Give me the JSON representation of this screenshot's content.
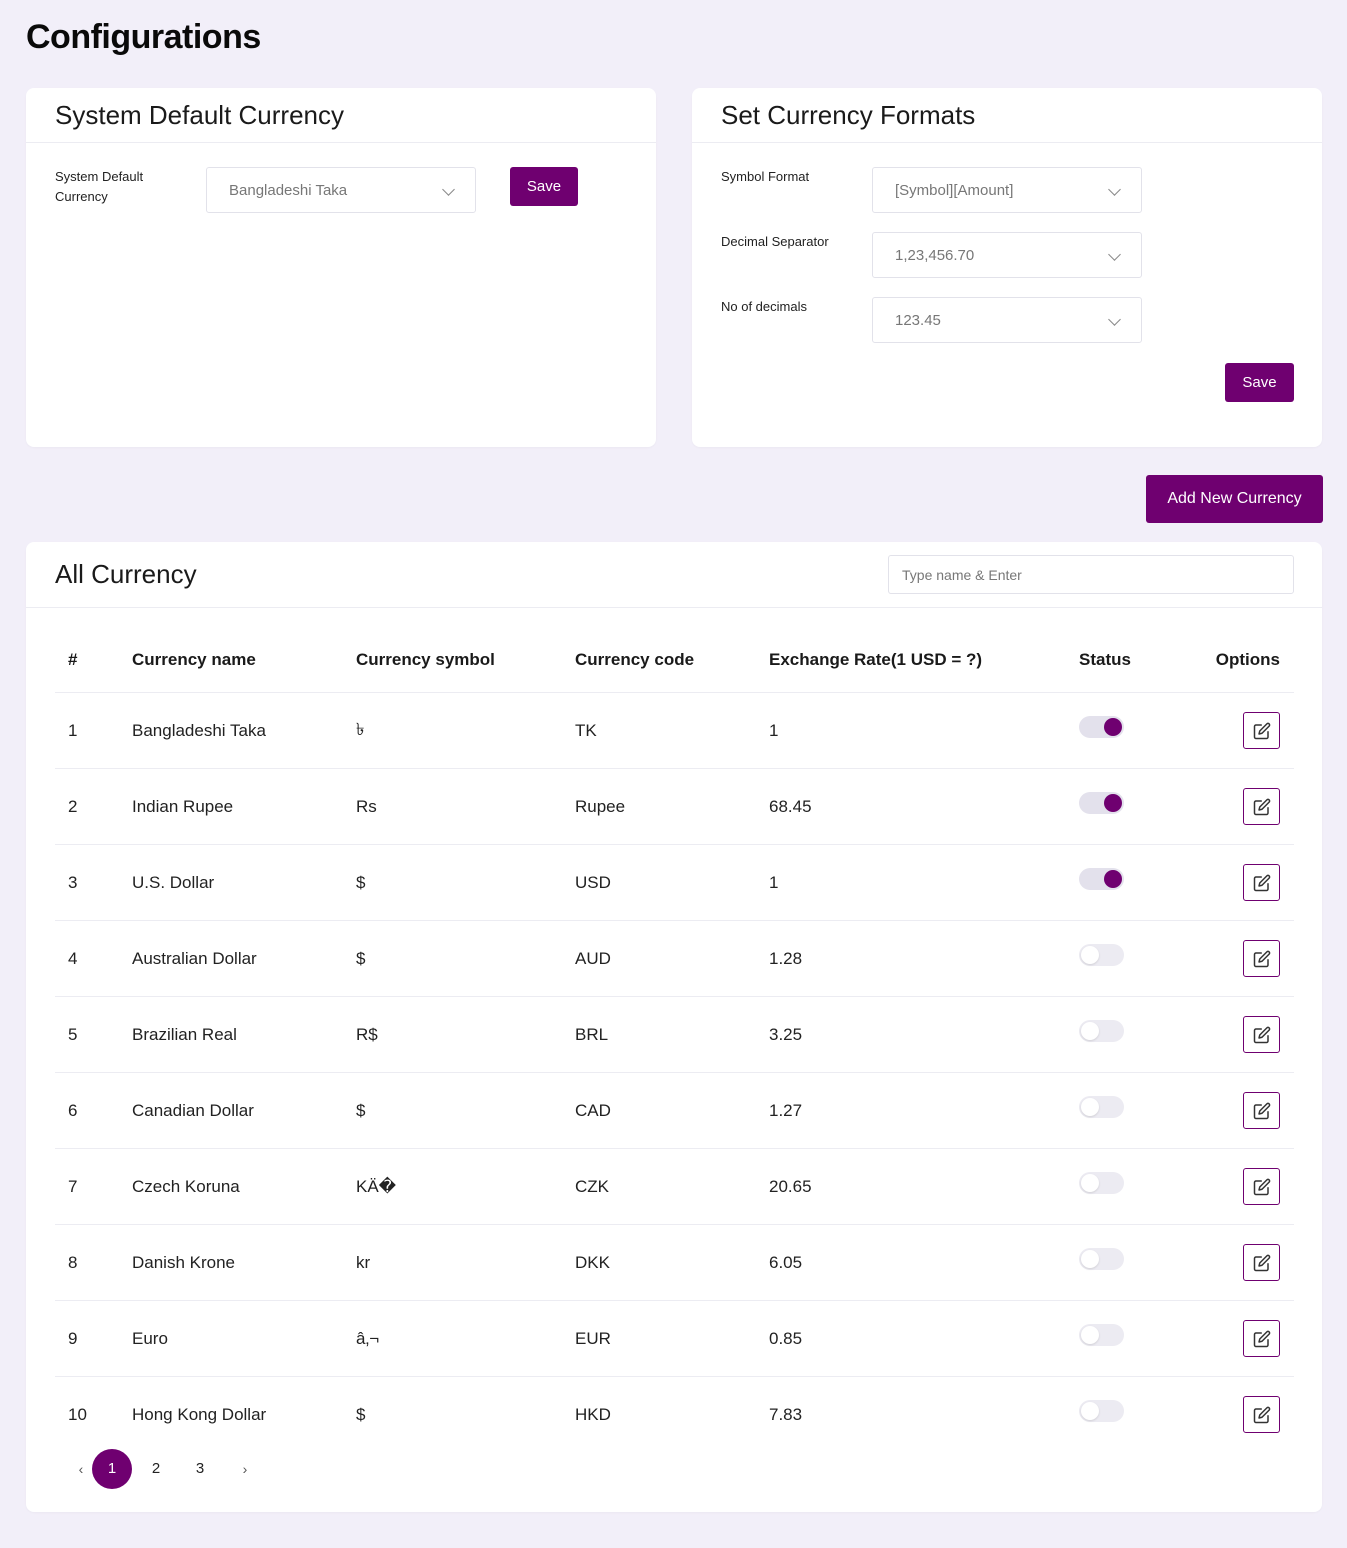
{
  "page": {
    "title": "Configurations"
  },
  "system_default": {
    "title": "System Default Currency",
    "label": "System Default Currency",
    "selected": "Bangladeshi Taka",
    "save_label": "Save"
  },
  "formats": {
    "title": "Set Currency Formats",
    "symbol_format": {
      "label": "Symbol Format",
      "value": "[Symbol][Amount]"
    },
    "decimal_separator": {
      "label": "Decimal Separator",
      "value": "1,23,456.70"
    },
    "no_of_decimals": {
      "label": "No of decimals",
      "value": "123.45"
    },
    "save_label": "Save"
  },
  "add_button_label": "Add New Currency",
  "all_currency": {
    "title": "All Currency",
    "search_placeholder": "Type name & Enter",
    "columns": [
      "#",
      "Currency name",
      "Currency symbol",
      "Currency code",
      "Exchange Rate(1 USD = ?)",
      "Status",
      "Options"
    ],
    "rows": [
      {
        "num": "1",
        "name": "Bangladeshi Taka",
        "symbol": "৳",
        "code": "TK",
        "rate": "1",
        "active": true
      },
      {
        "num": "2",
        "name": "Indian Rupee",
        "symbol": "Rs",
        "code": "Rupee",
        "rate": "68.45",
        "active": true
      },
      {
        "num": "3",
        "name": "U.S. Dollar",
        "symbol": "$",
        "code": "USD",
        "rate": "1",
        "active": true
      },
      {
        "num": "4",
        "name": "Australian Dollar",
        "symbol": "$",
        "code": "AUD",
        "rate": "1.28",
        "active": false
      },
      {
        "num": "5",
        "name": "Brazilian Real",
        "symbol": "R$",
        "code": "BRL",
        "rate": "3.25",
        "active": false
      },
      {
        "num": "6",
        "name": "Canadian Dollar",
        "symbol": "$",
        "code": "CAD",
        "rate": "1.27",
        "active": false
      },
      {
        "num": "7",
        "name": "Czech Koruna",
        "symbol": "KÄ�",
        "code": "CZK",
        "rate": "20.65",
        "active": false
      },
      {
        "num": "8",
        "name": "Danish Krone",
        "symbol": "kr",
        "code": "DKK",
        "rate": "6.05",
        "active": false
      },
      {
        "num": "9",
        "name": "Euro",
        "symbol": "â‚¬",
        "code": "EUR",
        "rate": "0.85",
        "active": false
      },
      {
        "num": "10",
        "name": "Hong Kong Dollar",
        "symbol": "$",
        "code": "HKD",
        "rate": "7.83",
        "active": false
      }
    ]
  },
  "pagination": {
    "prev": "‹",
    "next": "›",
    "pages": [
      "1",
      "2",
      "3"
    ],
    "current": "1"
  },
  "colors": {
    "accent": "#6f0070",
    "background": "#f2eff9"
  }
}
